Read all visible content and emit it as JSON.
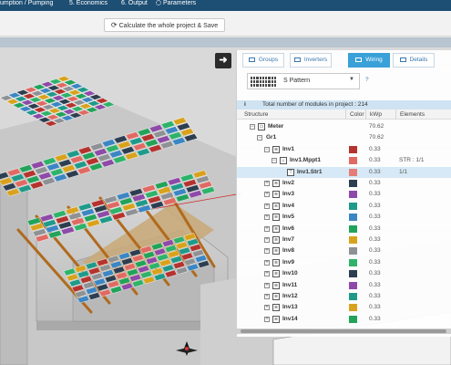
{
  "topnav": {
    "items": [
      "umption / Pumping",
      "5. Economics",
      "6. Output",
      "Parameters"
    ]
  },
  "toolbar": {
    "calc_label": "Calculate the whole project & Save"
  },
  "viewport": {
    "expand_symbol": "➜"
  },
  "panel": {
    "tabs": [
      {
        "label": "Groups",
        "active": false
      },
      {
        "label": "Inverters",
        "active": false
      },
      {
        "label": "Wiring",
        "active": true
      },
      {
        "label": "Details",
        "active": false
      }
    ],
    "pattern": {
      "selected": "S Pattern",
      "help": "?"
    },
    "info_icon": "i",
    "info_text": "Total number of modules in project : 214",
    "columns": [
      "Structure",
      "Color",
      "kWp",
      "Elements"
    ],
    "tree": [
      {
        "label": "Meter",
        "kwp": "70.62",
        "color": null,
        "elements": "",
        "toggle": "−",
        "icon": "▭",
        "bold": true,
        "selected": false
      },
      {
        "label": "Gr1",
        "kwp": "70.62",
        "color": null,
        "elements": "",
        "toggle": "−",
        "icon": "",
        "bold": true,
        "selected": false
      },
      {
        "label": "Inv1",
        "kwp": "0.33",
        "color": "#b5332e",
        "elements": "",
        "toggle": "−",
        "icon": "≋",
        "bold": true,
        "selected": false
      },
      {
        "label": "Inv1.Mppt1",
        "kwp": "0.33",
        "color": "#e06a63",
        "elements": "STR : 1/1",
        "toggle": "−",
        "icon": "⌂",
        "bold": true,
        "selected": false
      },
      {
        "label": "Inv1.Str1",
        "kwp": "0.33",
        "color": "#e47d78",
        "elements": "1/1",
        "toggle": "",
        "icon": "⊤",
        "bold": true,
        "selected": true
      },
      {
        "label": "Inv2",
        "kwp": "0.33",
        "color": "#2d3e50",
        "elements": "",
        "toggle": "+",
        "icon": "≋",
        "bold": true,
        "selected": false
      },
      {
        "label": "Inv3",
        "kwp": "0.33",
        "color": "#8e4aa8",
        "elements": "",
        "toggle": "+",
        "icon": "≋",
        "bold": true,
        "selected": false
      },
      {
        "label": "Inv4",
        "kwp": "0.33",
        "color": "#1f9a8a",
        "elements": "",
        "toggle": "+",
        "icon": "≋",
        "bold": true,
        "selected": false
      },
      {
        "label": "Inv5",
        "kwp": "0.33",
        "color": "#3b86c4",
        "elements": "",
        "toggle": "+",
        "icon": "≋",
        "bold": true,
        "selected": false
      },
      {
        "label": "Inv6",
        "kwp": "0.33",
        "color": "#22a35a",
        "elements": "",
        "toggle": "+",
        "icon": "≋",
        "bold": true,
        "selected": false
      },
      {
        "label": "Inv7",
        "kwp": "0.33",
        "color": "#d9a21c",
        "elements": "",
        "toggle": "+",
        "icon": "≋",
        "bold": true,
        "selected": false
      },
      {
        "label": "Inv8",
        "kwp": "0.33",
        "color": "#8f9294",
        "elements": "",
        "toggle": "+",
        "icon": "≋",
        "bold": true,
        "selected": false
      },
      {
        "label": "Inv9",
        "kwp": "0.33",
        "color": "#2eb36a",
        "elements": "",
        "toggle": "+",
        "icon": "≋",
        "bold": true,
        "selected": false
      },
      {
        "label": "Inv10",
        "kwp": "0.33",
        "color": "#2d3e50",
        "elements": "",
        "toggle": "+",
        "icon": "≋",
        "bold": true,
        "selected": false
      },
      {
        "label": "Inv11",
        "kwp": "0.33",
        "color": "#8e4aa8",
        "elements": "",
        "toggle": "+",
        "icon": "≋",
        "bold": true,
        "selected": false
      },
      {
        "label": "Inv12",
        "kwp": "0.33",
        "color": "#1f9a8a",
        "elements": "",
        "toggle": "+",
        "icon": "≋",
        "bold": true,
        "selected": false
      },
      {
        "label": "Inv13",
        "kwp": "0.33",
        "color": "#d9a21c",
        "elements": "",
        "toggle": "+",
        "icon": "≋",
        "bold": true,
        "selected": false
      },
      {
        "label": "Inv14",
        "kwp": "0.33",
        "color": "#22a35a",
        "elements": "",
        "toggle": "+",
        "icon": "≋",
        "bold": true,
        "selected": false
      }
    ]
  }
}
